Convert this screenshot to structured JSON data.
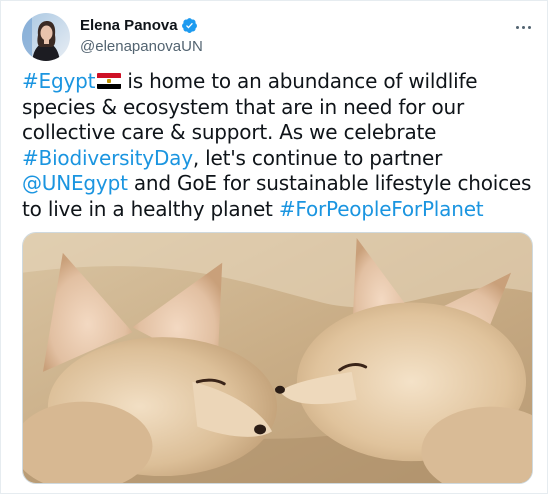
{
  "author": {
    "display_name": "Elena Panova",
    "handle": "@elenapanovaUN",
    "verified": true
  },
  "tweet": {
    "segments": [
      {
        "text": "#Egypt",
        "type": "hashtag"
      },
      {
        "text": " is home to an abundance of wildlife species & ecosystem that are in need for our collective care & support. As we celebrate ",
        "type": "text"
      },
      {
        "text": "#BiodiversityDay",
        "type": "hashtag"
      },
      {
        "text": ", let's continue to partner ",
        "type": "text"
      },
      {
        "text": "@UNEgypt",
        "type": "mention"
      },
      {
        "text": " and GoE for sustainable lifestyle choices to live in a healthy planet ",
        "type": "text"
      },
      {
        "text": "#ForPeopleForPlanet",
        "type": "hashtag"
      }
    ]
  },
  "icons": {
    "verified": "verified-badge-icon",
    "more": "more-options-icon",
    "flag": "egypt-flag-icon"
  },
  "colors": {
    "link": "#1b95e0",
    "verified": "#1d9bf0",
    "name": "#0f1419",
    "handle": "#536471"
  }
}
